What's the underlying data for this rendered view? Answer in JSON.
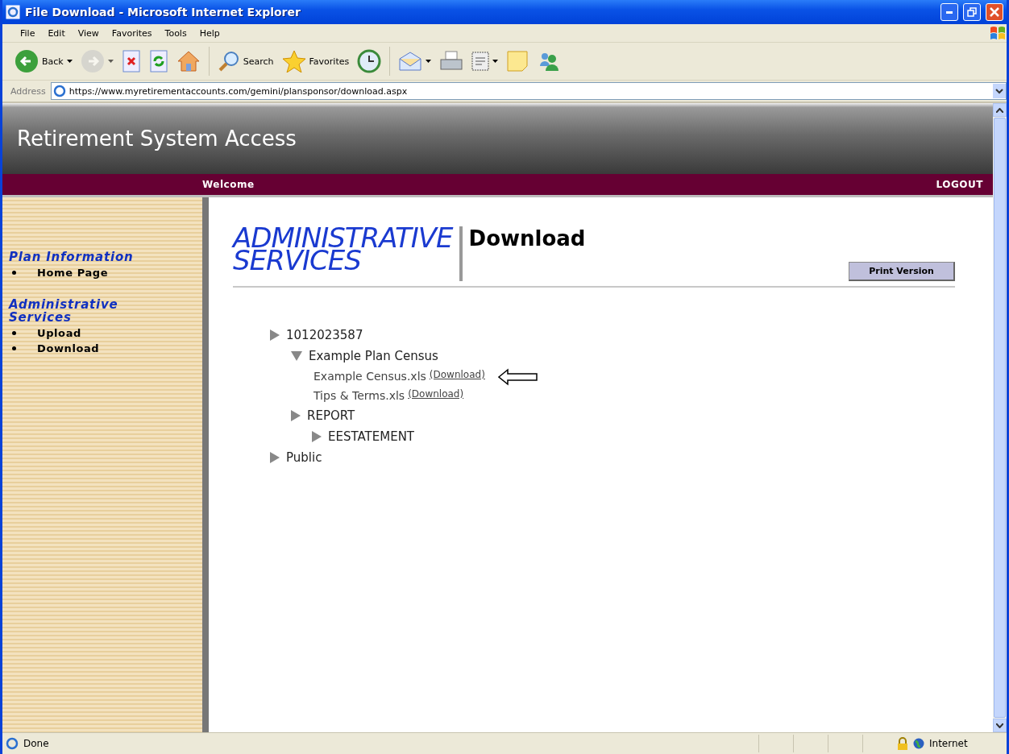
{
  "window": {
    "title": "File Download - Microsoft Internet Explorer"
  },
  "menu": [
    "File",
    "Edit",
    "View",
    "Favorites",
    "Tools",
    "Help"
  ],
  "toolbar": [
    {
      "kind": "back",
      "label": "Back",
      "dropdown": true,
      "disabled": false
    },
    {
      "kind": "forward",
      "dropdown": true,
      "disabled": true
    },
    {
      "kind": "stop",
      "dropdown": false,
      "disabled": false
    },
    {
      "kind": "refresh",
      "dropdown": false,
      "disabled": false
    },
    {
      "kind": "home",
      "dropdown": false,
      "disabled": false
    },
    {
      "kind": "search",
      "label": "Search",
      "dropdown": false,
      "disabled": false
    },
    {
      "kind": "favorites",
      "label": "Favorites",
      "dropdown": false,
      "disabled": false
    },
    {
      "kind": "history",
      "dropdown": false,
      "disabled": false
    },
    {
      "kind": "mail",
      "dropdown": true,
      "disabled": false
    },
    {
      "kind": "print",
      "dropdown": false,
      "disabled": false
    },
    {
      "kind": "edit",
      "dropdown": true,
      "disabled": false
    },
    {
      "kind": "note",
      "dropdown": false,
      "disabled": false
    },
    {
      "kind": "messenger",
      "dropdown": false,
      "disabled": false
    }
  ],
  "address": {
    "label": "Address",
    "value": "https://www.myretirementaccounts.com/gemini/plansponsor/download.aspx"
  },
  "page": {
    "site_title": "Retirement System Access",
    "nav_left": "Welcome",
    "nav_right": "LOGOUT",
    "sidebar": [
      {
        "heading": "Plan Information",
        "items": [
          "Home Page"
        ]
      },
      {
        "heading": "Administrative Services",
        "items": [
          "Upload",
          "Download"
        ]
      }
    ],
    "logo_lines": [
      "ADMINISTRATIVE",
      "SERVICES"
    ],
    "heading": "Download",
    "print_button": "Print Version",
    "tree": [
      {
        "kind": "folder",
        "label": "1012023587",
        "expanded": false,
        "children": [
          {
            "kind": "folder",
            "label": "Example Plan Census",
            "expanded": true,
            "children": [
              {
                "kind": "file",
                "label": "Example Census.xls",
                "link": "(Download)",
                "pointer": true
              },
              {
                "kind": "file",
                "label": "Tips & Terms.xls",
                "link": "(Download)",
                "pointer": false
              }
            ]
          },
          {
            "kind": "folder",
            "label": "REPORT",
            "expanded": false,
            "children": [
              {
                "kind": "folder",
                "label": "EESTATEMENT",
                "expanded": false
              }
            ]
          }
        ]
      },
      {
        "kind": "folder",
        "label": "Public",
        "expanded": false
      }
    ]
  },
  "status_bar": {
    "text": "Done",
    "zone": "Internet"
  }
}
